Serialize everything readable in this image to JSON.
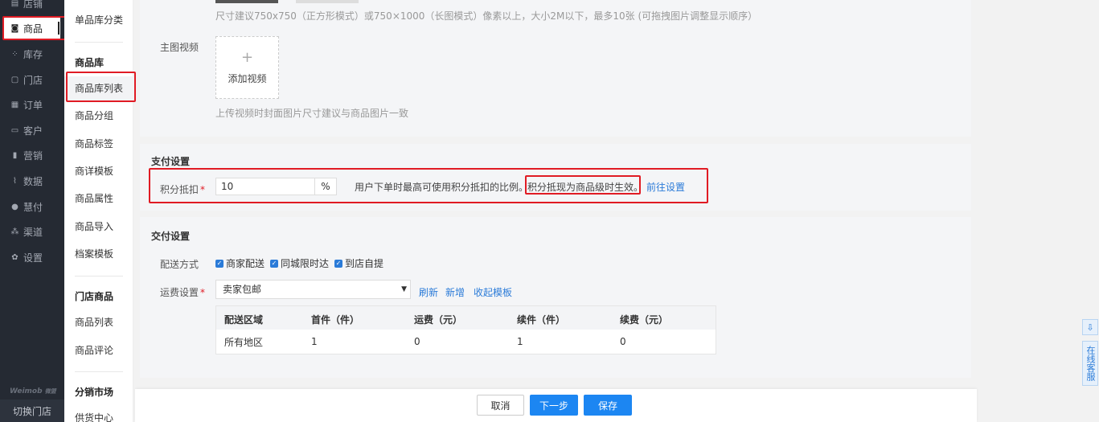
{
  "nav": {
    "items": [
      {
        "label": "店铺",
        "icon": "store-icon"
      },
      {
        "label": "商品",
        "icon": "goods-icon"
      },
      {
        "label": "库存",
        "icon": "inventory-icon"
      },
      {
        "label": "门店",
        "icon": "shop-icon"
      },
      {
        "label": "订单",
        "icon": "order-icon"
      },
      {
        "label": "客户",
        "icon": "customer-icon"
      },
      {
        "label": "营销",
        "icon": "marketing-icon"
      },
      {
        "label": "数据",
        "icon": "data-icon"
      },
      {
        "label": "慧付",
        "icon": "pay-icon"
      },
      {
        "label": "渠道",
        "icon": "channel-icon"
      },
      {
        "label": "设置",
        "icon": "gear-icon"
      }
    ],
    "brand": "Weimob",
    "brand_sub": "微盟",
    "switch_store": "切换门店"
  },
  "subnav": {
    "top_item": "单品库分类",
    "group1_title": "商品库",
    "group1_items": [
      "商品库列表",
      "商品分组",
      "商品标签",
      "商详模板",
      "商品属性",
      "商品导入",
      "档案模板"
    ],
    "group2_title": "门店商品",
    "group2_items": [
      "商品列表",
      "商品评论"
    ],
    "group3_title": "分销市场",
    "group3_items": [
      "供货中心"
    ]
  },
  "media": {
    "image_hint": "尺寸建议750x750（正方形模式）或750×1000（长图模式）像素以上，大小2M以下，最多10张 (可拖拽图片调整显示顺序）",
    "video_label": "主图视频",
    "add_video": "添加视频",
    "video_hint": "上传视频时封面图片尺寸建议与商品图片一致"
  },
  "payment": {
    "title": "支付设置",
    "points_label": "积分抵扣",
    "points_value": "10",
    "points_unit": "%",
    "desc": "用户下单时最高可使用积分抵扣的比例。",
    "desc_highlight": "积分抵现为商品级时生效。",
    "goto_link": "前往设置"
  },
  "delivery": {
    "title": "交付设置",
    "method_label": "配送方式",
    "methods": [
      "商家配送",
      "同城限时达",
      "到店自提"
    ],
    "fee_label": "运费设置",
    "fee_selected": "卖家包邮",
    "links": [
      "刷新",
      "新增",
      "收起模板"
    ],
    "table": {
      "headers": [
        "配送区域",
        "首件（件）",
        "运费（元）",
        "续件（件）",
        "续费（元）"
      ],
      "rows": [
        [
          "所有地区",
          "1",
          "0",
          "1",
          "0"
        ]
      ]
    }
  },
  "footer": {
    "cancel": "取消",
    "next": "下一步",
    "save": "保存"
  },
  "right_float": {
    "service": "在线客服"
  },
  "colors": {
    "accent": "#1c86f2",
    "link": "#2b7bd8",
    "highlight_border": "#e01b24",
    "nav_bg": "#252a33"
  }
}
